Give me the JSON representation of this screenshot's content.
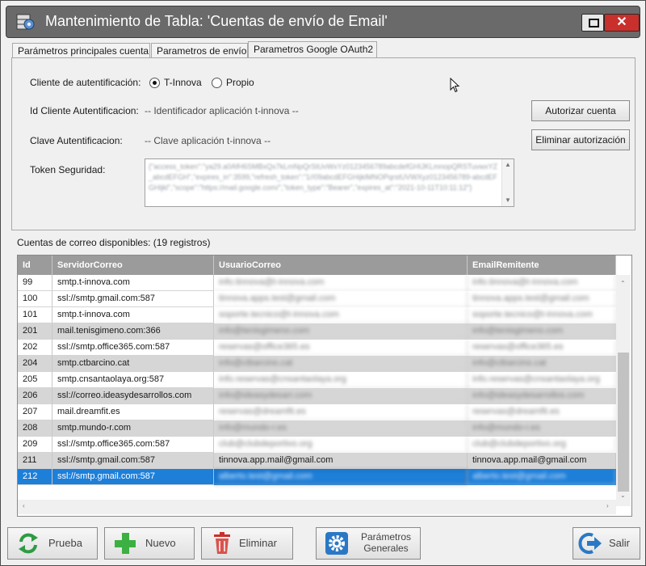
{
  "window": {
    "title": "Mantenimiento de Tabla: 'Cuentas de envío de Email'",
    "close_glyph": "✕"
  },
  "tabs": [
    {
      "label": "Parámetros principales cuenta",
      "active": false
    },
    {
      "label": "Parametros de envío",
      "active": false
    },
    {
      "label": "Parametros Google OAuth2",
      "active": true
    }
  ],
  "oauth": {
    "client_label": "Cliente de autentificación:",
    "option_tinnova": "T-Innova",
    "option_propio": "Propio",
    "selected": "T-Innova",
    "id_label": "Id Cliente Autentificacion:",
    "id_value": "-- Identificador aplicación t-innova --",
    "key_label": "Clave Autentificacion:",
    "key_value": "-- Clave aplicación t-innova --",
    "token_label": "Token Seguridad:",
    "token_value": "{\"access_token\":\"ya29.a0AfH6SMBxQx7kLmNpQrStUvWxYz0123456789abcdefGHIJKLmnopQRSTuvwxYZ_abcdEFGH\",\"expires_in\":3599,\"refresh_token\":\"1//09abcdEFGHijklMNOPqrstUVWXyz0123456789-abcdEFGHijkl\",\"scope\":\"https://mail.google.com/\",\"token_type\":\"Bearer\",\"expires_at\":\"2021-10-11T10:11:12\"}",
    "btn_authorize": "Autorizar cuenta",
    "btn_remove": "Eliminar autorización"
  },
  "grid": {
    "caption": "Cuentas de correo disponibles:  (19 registros)",
    "columns": [
      "Id",
      "ServidorCorreo",
      "UsuarioCorreo",
      "EmailRemitente"
    ],
    "rows": [
      {
        "id": "99",
        "server": "smtp.t-innova.com",
        "user": "info.tinnova@t-innova.com",
        "sender": "info.tinnova@t-innova.com",
        "blurred": true,
        "style": "white"
      },
      {
        "id": "100",
        "server": "ssl://smtp.gmail.com:587",
        "user": "tinnova.apps.test@gmail.com",
        "sender": "tinnova.apps.test@gmail.com",
        "blurred": true,
        "style": "white"
      },
      {
        "id": "101",
        "server": "smtp.t-innova.com",
        "user": "soporte.tecnico@t-innova.com",
        "sender": "soporte.tecnico@t-innova.com",
        "blurred": true,
        "style": "white"
      },
      {
        "id": "201",
        "server": "mail.tenisgimeno.com:366",
        "user": "info@tenisgimeno.com",
        "sender": "info@tenisgimeno.com",
        "blurred": true,
        "style": "gray"
      },
      {
        "id": "202",
        "server": "ssl://smtp.office365.com:587",
        "user": "reservas@office365.es",
        "sender": "reservas@office365.es",
        "blurred": true,
        "style": "white"
      },
      {
        "id": "204",
        "server": "smtp.ctbarcino.cat",
        "user": "info@ctbarcino.cat",
        "sender": "info@ctbarcino.cat",
        "blurred": true,
        "style": "gray"
      },
      {
        "id": "205",
        "server": "smtp.cnsantaolaya.org:587",
        "user": "info.reservas@cnsantaolaya.org",
        "sender": "info.reservas@cnsantaolaya.org",
        "blurred": true,
        "style": "white"
      },
      {
        "id": "206",
        "server": "ssl://correo.ideasydesarrollos.com",
        "user": "info@ideasydesarr.com",
        "sender": "info@ideasydesarrollos.com",
        "blurred": true,
        "style": "gray"
      },
      {
        "id": "207",
        "server": "mail.dreamfit.es",
        "user": "reservas@dreamfit.es",
        "sender": "reservas@dreamfit.es",
        "blurred": true,
        "style": "white"
      },
      {
        "id": "208",
        "server": "smtp.mundo-r.com",
        "user": "info@mundo-r.es",
        "sender": "info@mundo-r.es",
        "blurred": true,
        "style": "gray"
      },
      {
        "id": "209",
        "server": "ssl://smtp.office365.com:587",
        "user": "club@clubdeportivo.org",
        "sender": "club@clubdeportivo.org",
        "blurred": true,
        "style": "white"
      },
      {
        "id": "211",
        "server": "ssl://smtp.gmail.com:587",
        "user": "tinnova.app.mail@gmail.com",
        "sender": "tinnova.app.mail@gmail.com",
        "blurred": false,
        "style": "gray"
      },
      {
        "id": "212",
        "server": "ssl://smtp.gmail.com:587",
        "user": "alberto.test@gmail.com",
        "sender": "alberto.test@gmail.com",
        "blurred": true,
        "style": "selected"
      }
    ]
  },
  "buttons": {
    "prueba": "Prueba",
    "nuevo": "Nuevo",
    "eliminar": "Eliminar",
    "parametros_1": "Parámetros",
    "parametros_2": "Generales",
    "salir": "Salir"
  },
  "colors": {
    "titlebar": "#6a6a6a",
    "selection": "#1e7fd9",
    "header": "#9b9b9b",
    "add": "#3cb043",
    "delete": "#d9534f",
    "settings": "#2a78c5",
    "refresh": "#2e9b44"
  },
  "icons": {
    "app": "gear-table-icon",
    "prueba": "refresh-icon",
    "nuevo": "plus-icon",
    "eliminar": "trash-icon",
    "parametros": "gear-icon",
    "salir": "exit-icon"
  }
}
